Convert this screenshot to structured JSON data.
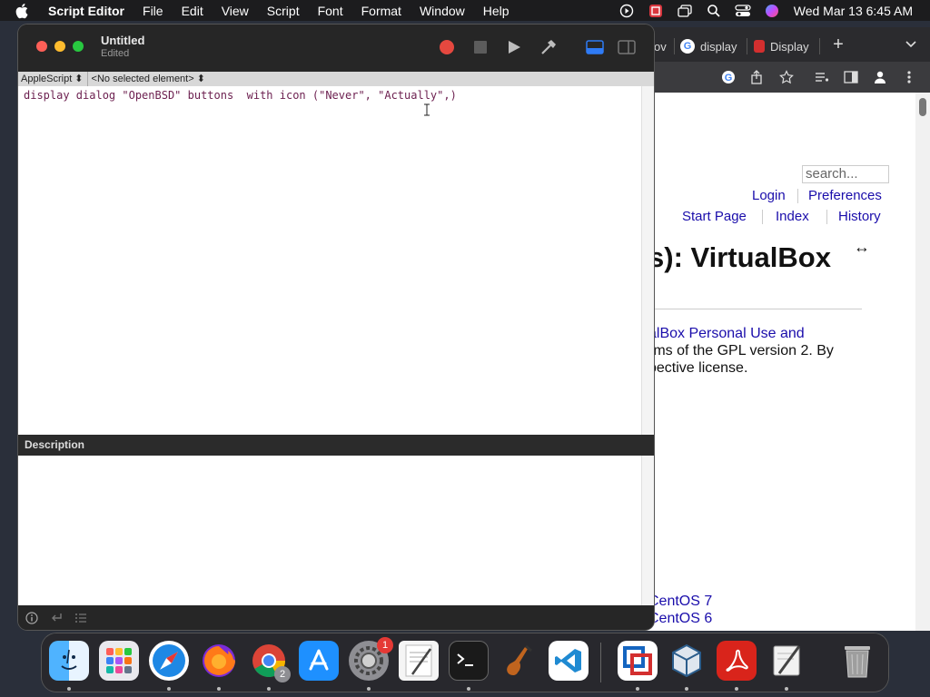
{
  "menubar": {
    "app_name": "Script Editor",
    "menus": [
      "File",
      "Edit",
      "View",
      "Script",
      "Font",
      "Format",
      "Window",
      "Help"
    ],
    "clock": "Wed Mar 13  6:45 AM"
  },
  "script_editor": {
    "title": "Untitled",
    "subtitle": "Edited",
    "language_selector": "AppleScript ⬍",
    "element_selector": "<No selected element> ⬍",
    "code": "display dialog \"OpenBSD\" buttons  with icon (\"Never\", \"Actually\",)",
    "description_header": "Description",
    "colors": {
      "record": "#e5483f",
      "accent": "#2f7bf5"
    }
  },
  "chrome": {
    "tabs": [
      {
        "label": "ov"
      },
      {
        "label": "display"
      },
      {
        "label": "Display"
      }
    ],
    "page": {
      "search_placeholder": "search...",
      "links_row1": [
        "Login",
        "Preferences"
      ],
      "links_row2": [
        "Start Page",
        "Index",
        "History"
      ],
      "title": "s): VirtualBox",
      "para_line1": "alBox Personal Use and",
      "para_line2": "rms of the GPL version 2. By",
      "para_line3": "pective license.",
      "bottom_links": [
        "CentOS 7",
        "CentOS 6"
      ]
    }
  },
  "dock": {
    "apps": [
      {
        "name": "Finder"
      },
      {
        "name": "Launchpad"
      },
      {
        "name": "Safari"
      },
      {
        "name": "Firefox"
      },
      {
        "name": "Google Chrome",
        "badge": "2"
      },
      {
        "name": "App Store"
      },
      {
        "name": "System Settings",
        "badge": "1"
      },
      {
        "name": "TextEdit"
      },
      {
        "name": "Terminal"
      },
      {
        "name": "GarageBand"
      },
      {
        "name": "Visual Studio Code"
      },
      {
        "name": "Parallels"
      },
      {
        "name": "VirtualBox"
      },
      {
        "name": "Acrobat"
      },
      {
        "name": "Script Editor"
      },
      {
        "name": "Trash"
      }
    ]
  }
}
